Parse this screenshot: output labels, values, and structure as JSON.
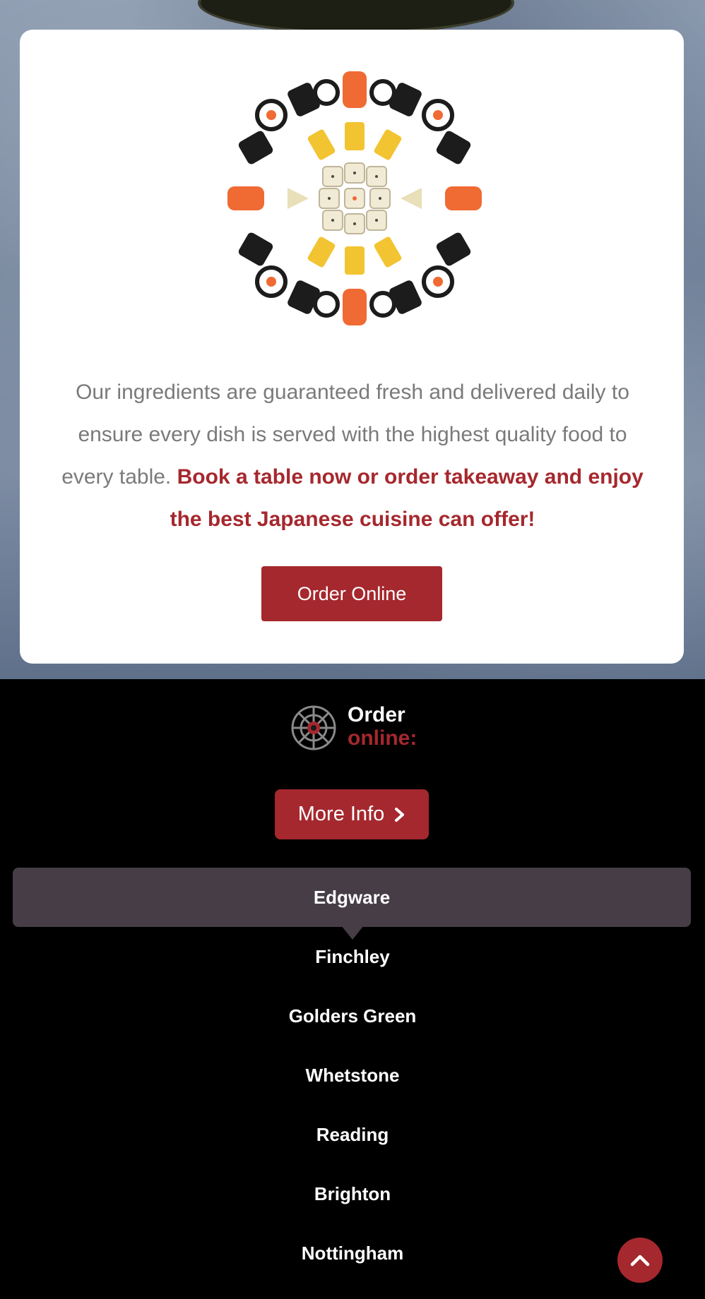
{
  "intro": {
    "text": "Our ingredients are guaranteed fresh and delivered daily to ensure every dish is served with the highest quality food to every table.",
    "highlight": "Book a table now or order takeaway and enjoy the best Japanese cuisine can offer!"
  },
  "buttons": {
    "order_online": "Order Online",
    "more_info": "More Info"
  },
  "logo": {
    "line1": "Order",
    "line2": "online:"
  },
  "locations": {
    "active": "Edgware",
    "items": [
      "Edgware",
      "Finchley",
      "Golders Green",
      "Whetstone",
      "Reading",
      "Brighton",
      "Nottingham"
    ]
  },
  "icons": {
    "sushi_image": "sushi-platter-image",
    "logo": "mandala-logo-icon",
    "more_info_arrow": "chevron-right-icon",
    "scroll_top": "chevron-up-icon"
  },
  "colors": {
    "brand_red": "#a5282e",
    "active_location_bg": "#463d47",
    "footer_bg": "#000000",
    "card_bg": "#ffffff"
  }
}
